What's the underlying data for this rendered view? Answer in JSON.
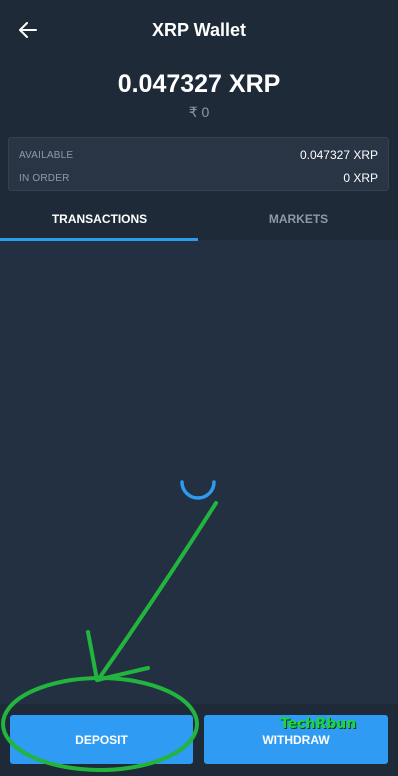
{
  "header": {
    "title": "XRP Wallet",
    "balance": "0.047327 XRP",
    "fiat_balance": "₹ 0",
    "back_icon": "arrow-left-icon"
  },
  "summary": {
    "available_label": "AVAILABLE",
    "available_value": "0.047327 XRP",
    "in_order_label": "IN ORDER",
    "in_order_value": "0 XRP"
  },
  "tabs": [
    {
      "label": "TRANSACTIONS",
      "active": true
    },
    {
      "label": "MARKETS",
      "active": false
    }
  ],
  "actions": {
    "deposit_label": "DEPOSIT",
    "withdraw_label": "WITHDRAW"
  },
  "watermark": "TechRbun",
  "colors": {
    "accent": "#2f9bf2",
    "annotation": "#22b53e"
  }
}
